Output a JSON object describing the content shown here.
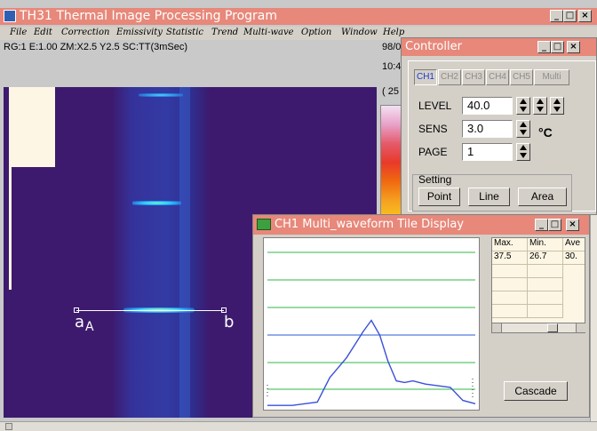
{
  "main_window": {
    "title": "TH31 Thermal Image Processing Program",
    "status_line": "RG:1  E:1.00  ZM:X2.5 Y2.5  SC:TT(3mSec)",
    "status_right1": "98/0",
    "status_right2": "10:4",
    "status_right3": "( 25",
    "buttons": {
      "minimize": "_",
      "maximize": "□",
      "close": "×"
    }
  },
  "menu": [
    "File",
    "Edit",
    "Correction",
    "Emissivity",
    "Statistic",
    "Trend",
    "Multi-wave",
    "Option",
    "Window",
    "Help"
  ],
  "thermal_view": {
    "marker_a": "a",
    "marker_a2": "A",
    "marker_b": "b"
  },
  "controller": {
    "title": "Controller",
    "tabs": [
      "CH1",
      "CH2",
      "CH3",
      "CH4",
      "CH5",
      "Multi"
    ],
    "level_label": "LEVEL",
    "level_value": "40.0",
    "sens_label": "SENS",
    "sens_value": "3.0",
    "unit": "°C",
    "page_label": "PAGE",
    "page_value": "1",
    "setting_label": "Setting",
    "setting_buttons": [
      "Point",
      "Line",
      "Area"
    ]
  },
  "waveform_window": {
    "title": "CH1 Multi_waveform Tile Display",
    "table_headers": [
      "Max.",
      "Min.",
      "Ave"
    ],
    "table_values": [
      "37.5",
      "26.7",
      "30."
    ],
    "cascade_label": "Cascade"
  },
  "chart_data": {
    "type": "line",
    "title": "",
    "xlabel": "",
    "ylabel": "",
    "grid": true,
    "x": [
      0,
      0.06,
      0.12,
      0.18,
      0.24,
      0.3,
      0.34,
      0.38,
      0.42,
      0.46,
      0.5,
      0.54,
      0.58,
      0.62,
      0.66,
      0.7,
      0.76,
      0.82,
      0.88,
      0.94,
      1
    ],
    "series": [
      {
        "values": [
          0.01,
          0.01,
          0.01,
          0.02,
          0.03,
          0.18,
          0.24,
          0.3,
          0.38,
          0.46,
          0.53,
          0.44,
          0.28,
          0.16,
          0.15,
          0.16,
          0.14,
          0.13,
          0.12,
          0.04,
          0.02
        ],
        "color": "#3a50d8"
      }
    ]
  },
  "colors": {
    "titlebar": "#e7887a",
    "thermal_bg": "#3d1a6e",
    "chart_line": "#3a50d8",
    "grid_line": "#2fb94a"
  }
}
